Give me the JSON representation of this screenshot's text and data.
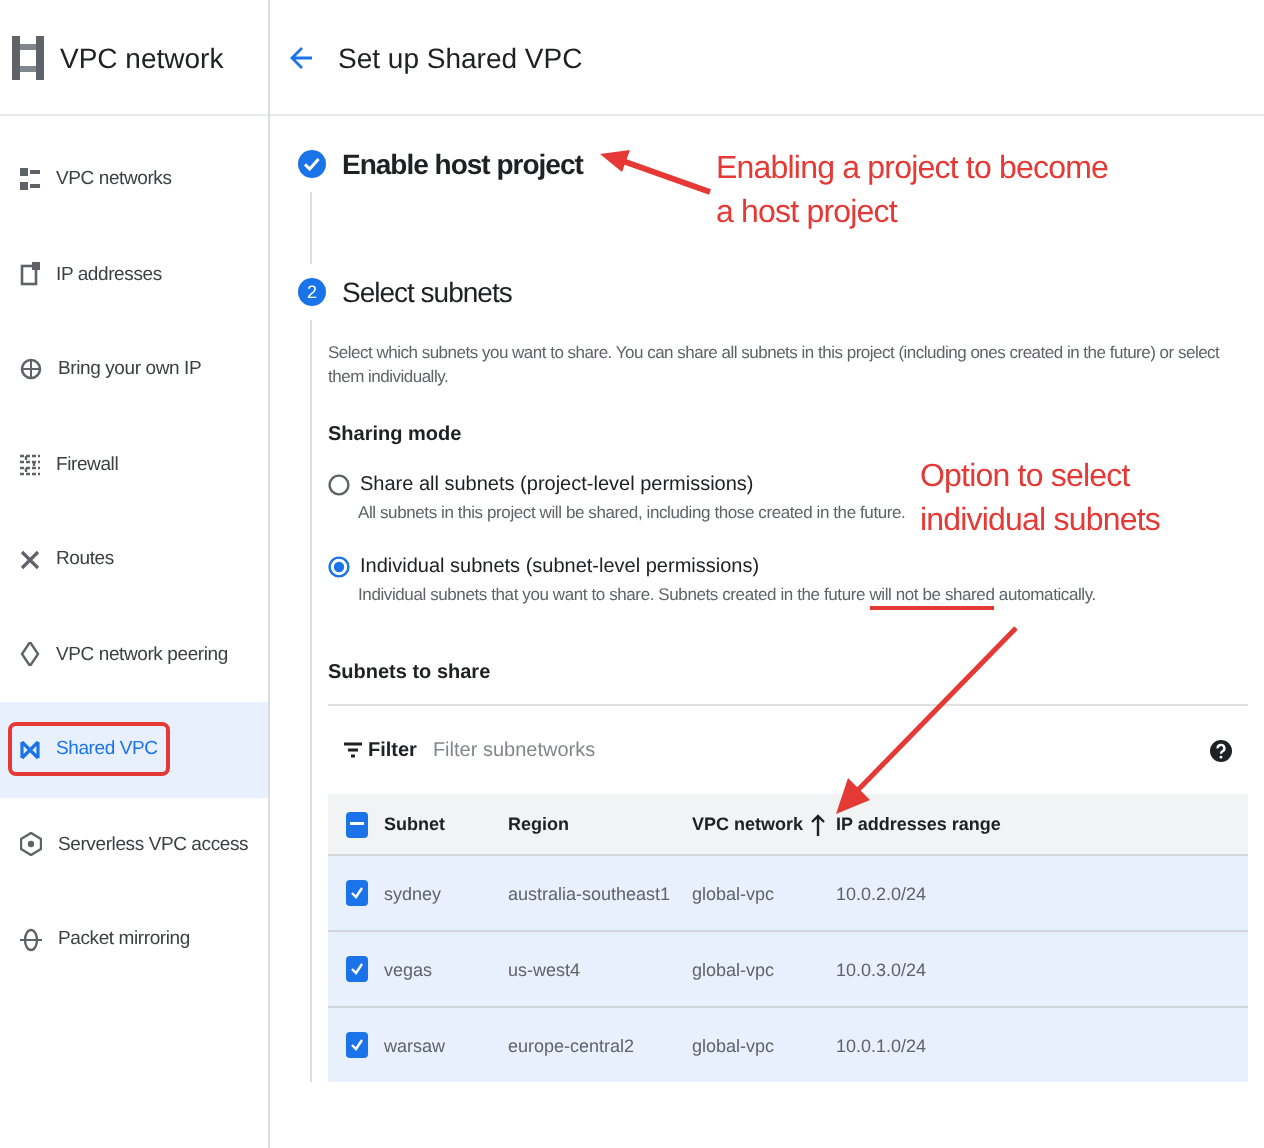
{
  "sidebar": {
    "title": "VPC network",
    "items": [
      {
        "label": "VPC networks",
        "selected": false,
        "highlighted": false
      },
      {
        "label": "IP addresses",
        "selected": false,
        "highlighted": false
      },
      {
        "label": "Bring your own IP",
        "selected": false,
        "highlighted": false
      },
      {
        "label": "Firewall",
        "selected": false,
        "highlighted": false
      },
      {
        "label": "Routes",
        "selected": false,
        "highlighted": false
      },
      {
        "label": "VPC network peering",
        "selected": false,
        "highlighted": false
      },
      {
        "label": "Shared VPC",
        "selected": true,
        "highlighted": true
      },
      {
        "label": "Serverless VPC access",
        "selected": false,
        "highlighted": false
      },
      {
        "label": "Packet mirroring",
        "selected": false,
        "highlighted": false
      }
    ]
  },
  "header": {
    "title": "Set up Shared VPC"
  },
  "steps": [
    {
      "title": "Enable host project",
      "completed": true
    },
    {
      "number": "2",
      "title": "Select subnets",
      "completed": false
    }
  ],
  "description": "Select which subnets you want to share. You can share all subnets in this project (including ones created in the future) or select them individually.",
  "sharing_mode": {
    "label": "Sharing mode",
    "options": [
      {
        "label": "Share all subnets (project-level permissions)",
        "selected": false,
        "help": [
          {
            "text": "All subnets in this project will be shared, including those created in the future.",
            "underlined": false
          }
        ]
      },
      {
        "label": "Individual subnets (subnet-level permissions)",
        "selected": true,
        "help": [
          {
            "text": "Individual subnets that you want to share. Subnets created in the future ",
            "underlined": false
          },
          {
            "text": "will not be shared",
            "underlined": true
          },
          {
            "text": " automatically.",
            "underlined": false
          }
        ]
      }
    ]
  },
  "subnets": {
    "label": "Subnets to share",
    "filter": {
      "label": "Filter",
      "placeholder": "Filter subnetworks"
    },
    "select_all_indeterminate": true,
    "columns": [
      {
        "label": "Subnet",
        "sorted": false
      },
      {
        "label": "Region",
        "sorted": false
      },
      {
        "label": "VPC network",
        "sorted": true
      },
      {
        "label": "IP addresses range",
        "sorted": false
      }
    ],
    "rows": [
      {
        "checked": true,
        "cells": [
          "sydney",
          "australia-southeast1",
          "global-vpc",
          "10.0.2.0/24"
        ]
      },
      {
        "checked": true,
        "cells": [
          "vegas",
          "us-west4",
          "global-vpc",
          "10.0.3.0/24"
        ]
      },
      {
        "checked": true,
        "cells": [
          "warsaw",
          "europe-central2",
          "global-vpc",
          "10.0.1.0/24"
        ]
      }
    ]
  },
  "annotations": [
    {
      "lines": [
        "Enabling a project to become",
        "a host project"
      ]
    },
    {
      "lines": [
        "Option to select",
        "individual  subnets"
      ]
    }
  ]
}
